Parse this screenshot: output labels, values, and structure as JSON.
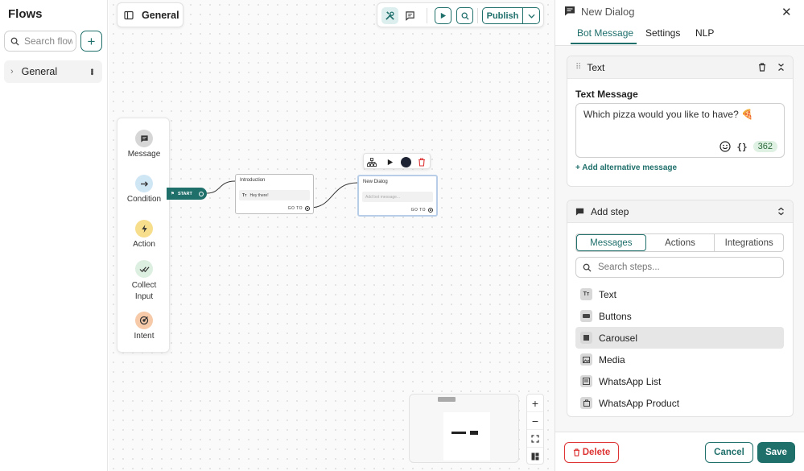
{
  "sidebar": {
    "title": "Flows",
    "search_placeholder": "Search flows",
    "flows": [
      {
        "label": "General"
      }
    ]
  },
  "canvas": {
    "flow_name": "General",
    "publish_label": "Publish",
    "palette": [
      {
        "label": "Message",
        "icon": "message-icon"
      },
      {
        "label": "Condition",
        "icon": "arrow-right-icon"
      },
      {
        "label": "Action",
        "icon": "bolt-icon"
      },
      {
        "label": "Collect Input",
        "icon": "double-check-icon"
      },
      {
        "label": "Intent",
        "icon": "target-icon"
      }
    ],
    "start_label": "START",
    "nodes": [
      {
        "title": "Introduction",
        "body": "Hey there!",
        "goto": "GO TO"
      },
      {
        "title": "New Dialog",
        "body": "Add bot message...",
        "goto": "GO TO"
      }
    ]
  },
  "panel": {
    "title": "New Dialog",
    "tabs": [
      "Bot Message",
      "Settings",
      "NLP"
    ],
    "text_card": {
      "header": "Text",
      "field_label": "Text Message",
      "message": "Which pizza would you like to have? 🍕",
      "char_count": "362",
      "alt_link": "+ Add alternative message"
    },
    "add_step": {
      "header": "Add step",
      "segments": [
        "Messages",
        "Actions",
        "Integrations"
      ],
      "search_placeholder": "Search steps...",
      "steps": [
        "Text",
        "Buttons",
        "Carousel",
        "Media",
        "WhatsApp List",
        "WhatsApp Product"
      ]
    },
    "footer": {
      "delete_label": "Delete",
      "cancel_label": "Cancel",
      "save_label": "Save"
    }
  },
  "colors": {
    "accent": "#1f6f6b",
    "danger": "#dd3333"
  }
}
